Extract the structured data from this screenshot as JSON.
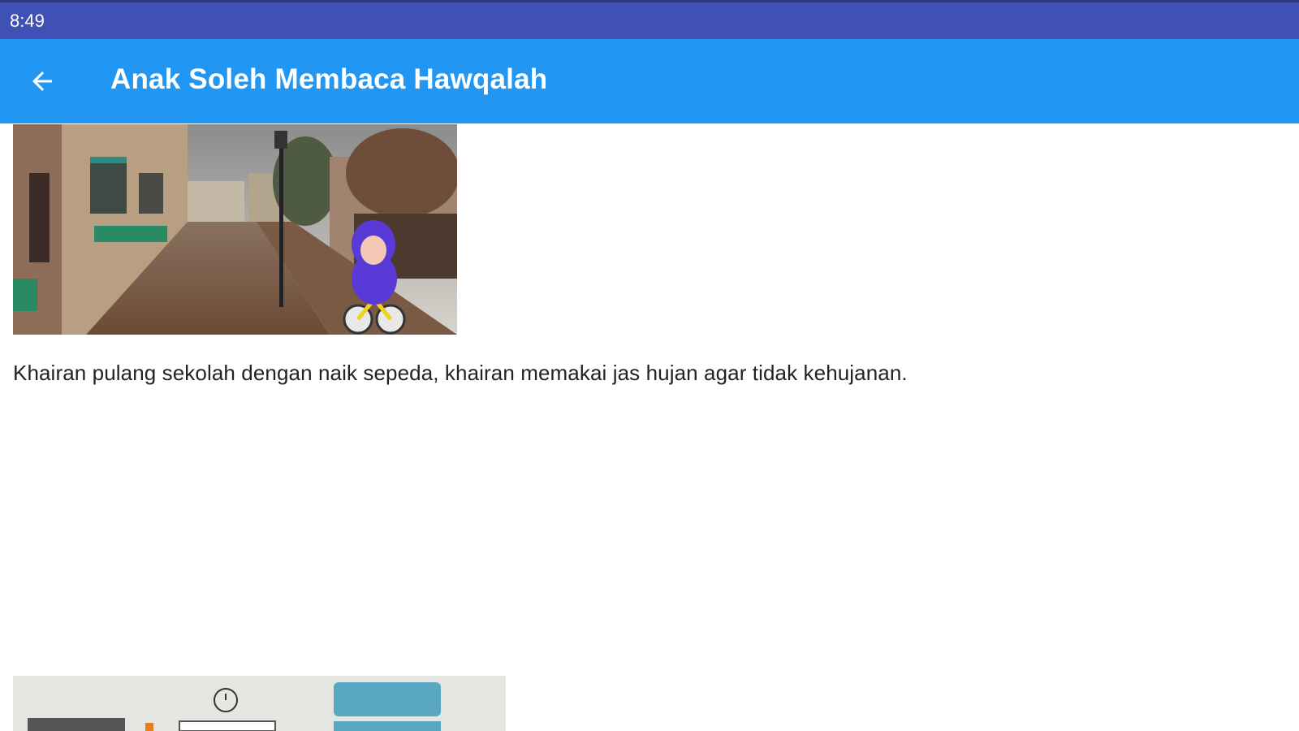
{
  "status_bar": {
    "time": "8:49"
  },
  "app_bar": {
    "title": "Anak Soleh Membaca Hawqalah",
    "back_icon": "arrow-left-icon"
  },
  "colors": {
    "status_bar": "#3f51b5",
    "app_bar": "#2196f3",
    "background": "#ffffff",
    "text": "#222222"
  },
  "content": {
    "story_text": "Khairan pulang sekolah dengan naik sepeda, khairan memakai jas hujan agar tidak kehujanan."
  }
}
